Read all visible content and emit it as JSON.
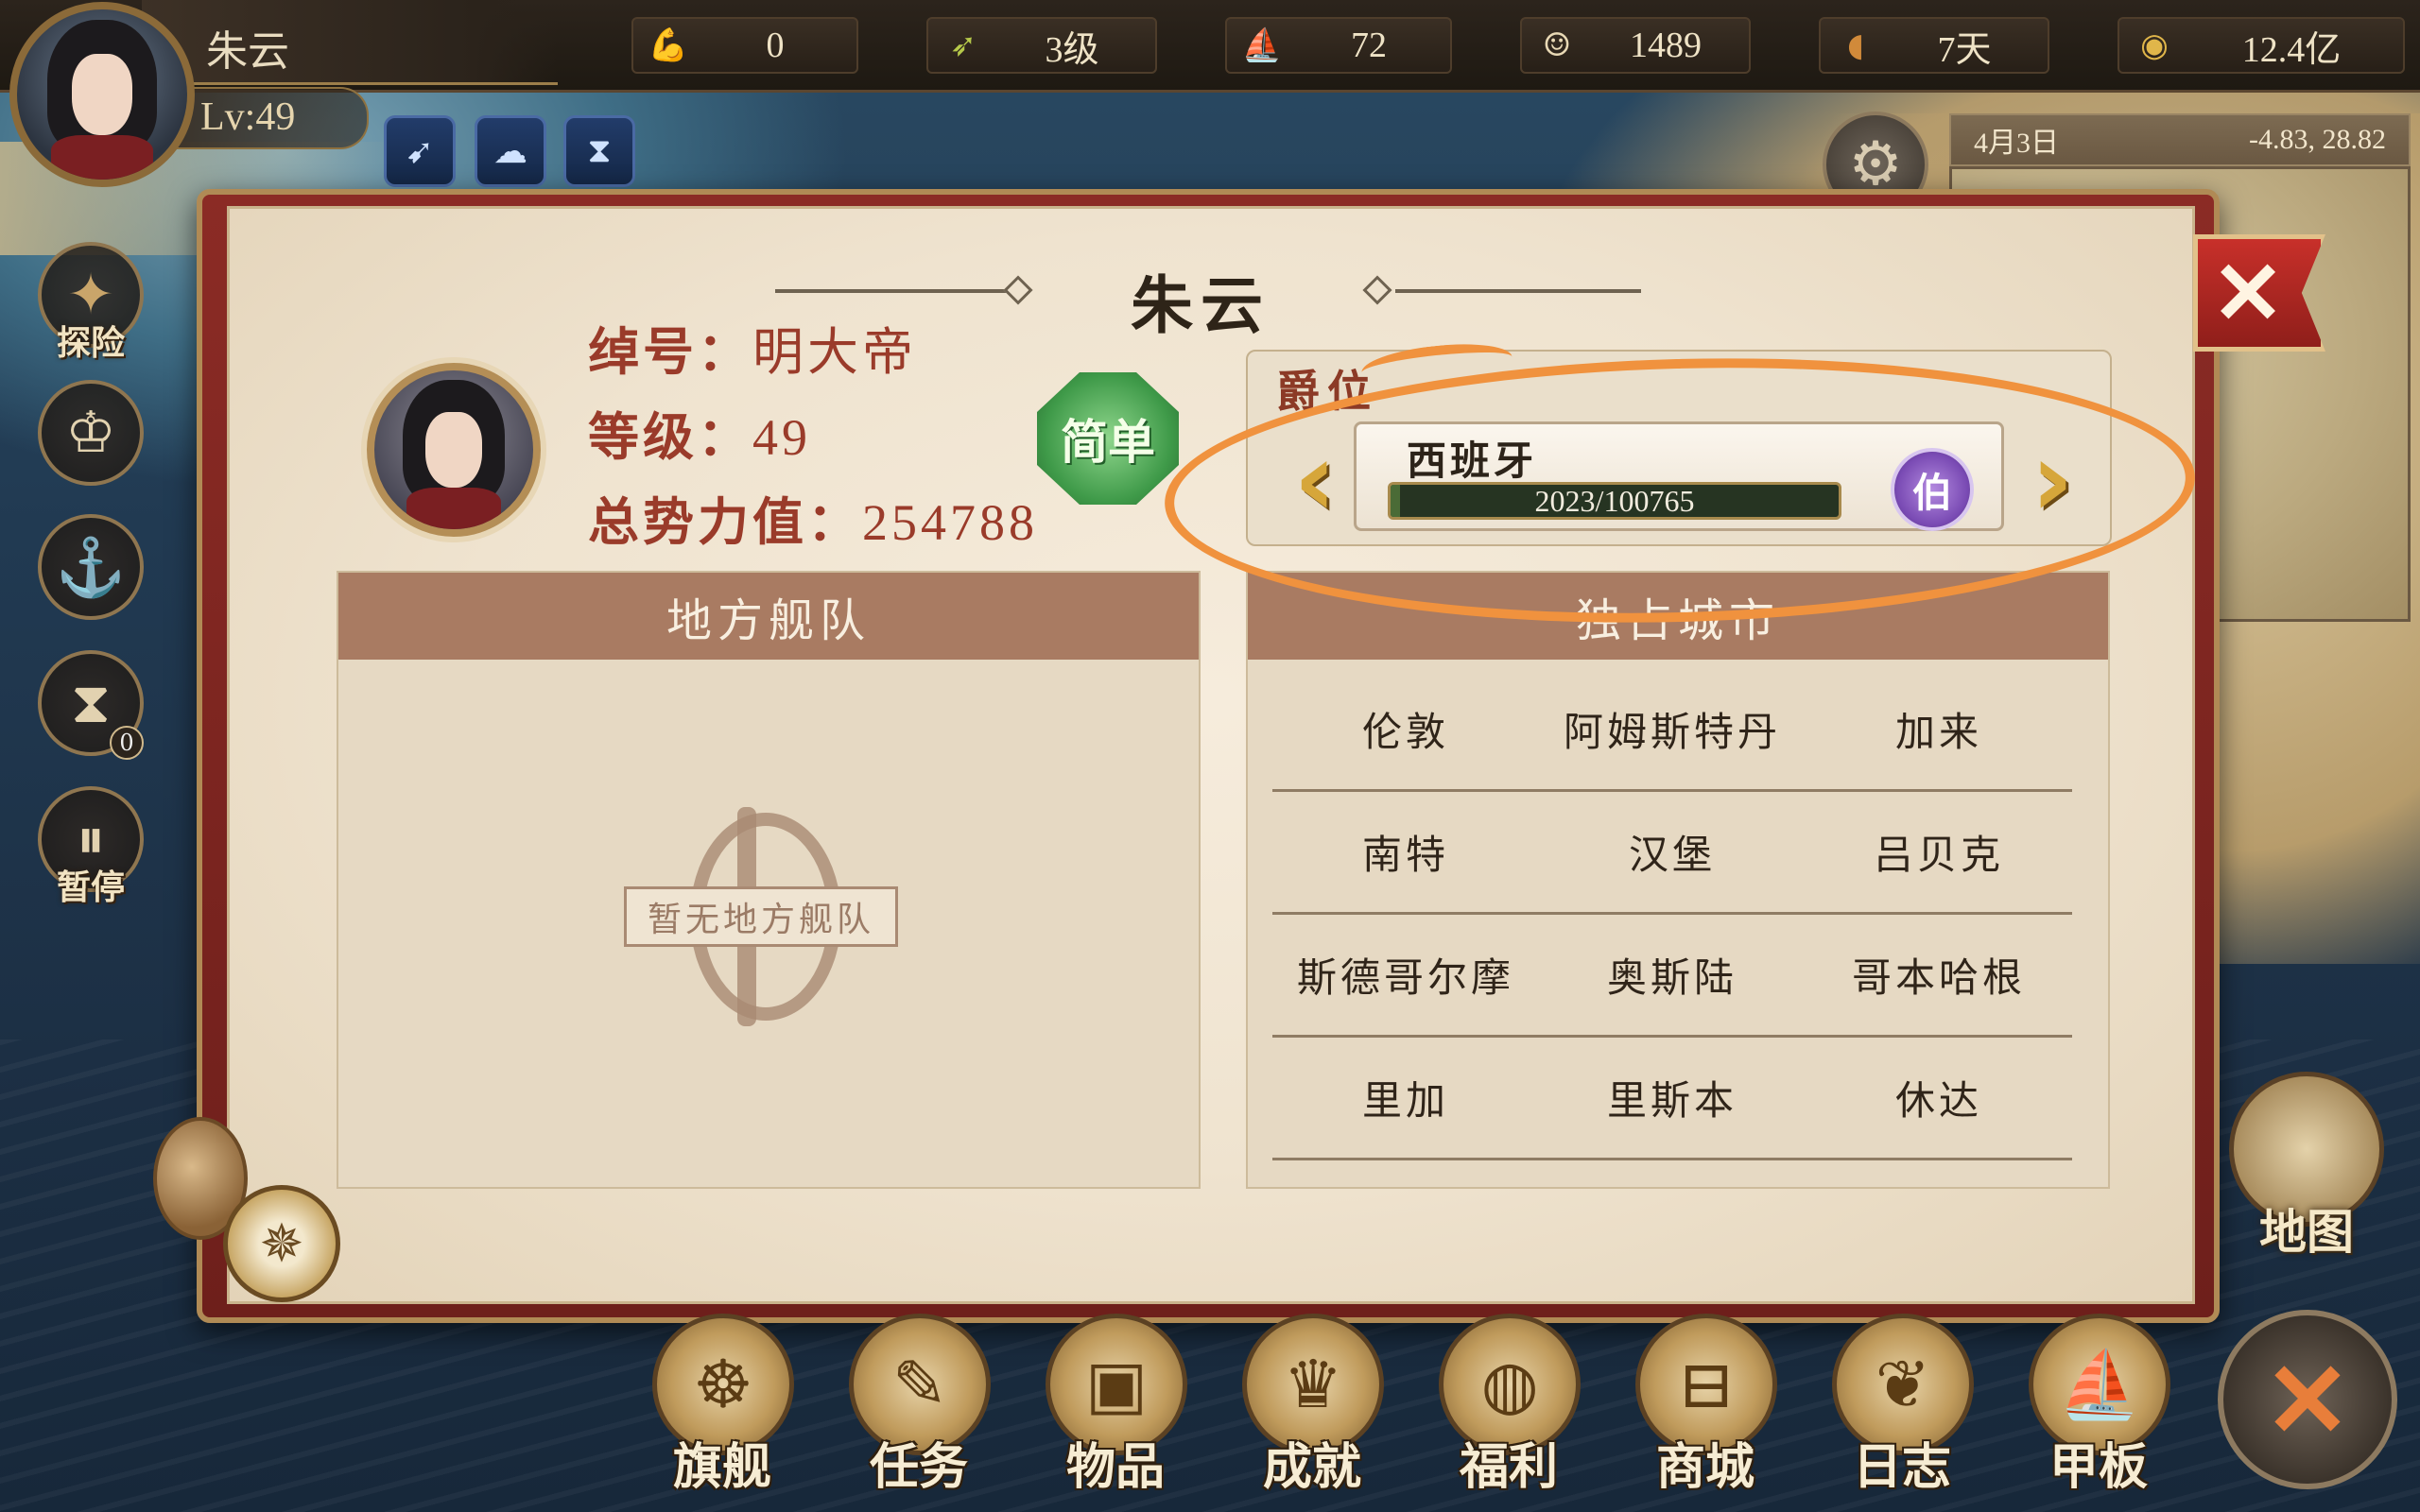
{
  "player": {
    "name": "朱云",
    "level_text": "Lv:49"
  },
  "resources": [
    {
      "icon": "strength-arm-icon",
      "value": "0"
    },
    {
      "icon": "arrow-icon",
      "value": "3级"
    },
    {
      "icon": "ship-icon",
      "value": "72"
    },
    {
      "icon": "sailor-icon",
      "value": "1489"
    },
    {
      "icon": "bread-icon",
      "value": "7天"
    },
    {
      "icon": "gold-coin-icon",
      "value": "12.4亿"
    }
  ],
  "buffs": [
    "feather-buff-icon",
    "brain-buff-icon",
    "hourglass-buff-icon"
  ],
  "date_box": {
    "date": "4月3日",
    "coords": "-4.83, 28.82"
  },
  "side_menu": {
    "explore_label": "探险",
    "pause_label": "暂停",
    "hourglass_badge": "0"
  },
  "map_button": {
    "label": "地图"
  },
  "bottom_menu": [
    {
      "label": "旗舰",
      "icon": "helm-wheel-icon"
    },
    {
      "label": "任务",
      "icon": "scroll-quill-icon"
    },
    {
      "label": "物品",
      "icon": "satchel-icon"
    },
    {
      "label": "成就",
      "icon": "trophy-icon"
    },
    {
      "label": "福利",
      "icon": "money-bag-icon"
    },
    {
      "label": "商城",
      "icon": "treasure-chest-icon"
    },
    {
      "label": "日志",
      "icon": "journal-icon"
    },
    {
      "label": "甲板",
      "icon": "sailing-ship-icon"
    }
  ],
  "dialog": {
    "title": "朱云",
    "close_symbol": "✕",
    "profile": {
      "title_label": "绰号：",
      "title_value": "明大帝",
      "level_label": "等级：",
      "level_value": "49",
      "power_label": "总势力值：",
      "power_value": "254788"
    },
    "difficulty": "简单",
    "nobility": {
      "section_title": "爵位",
      "nation": "西班牙",
      "progress_text": "2023/100765",
      "progress_current": 2023,
      "progress_max": 100765,
      "rank": "伯",
      "prev_symbol": "‹",
      "next_symbol": "›"
    },
    "local_fleet": {
      "header": "地方舰队",
      "empty_text": "暂无地方舰队"
    },
    "monopoly_cities": {
      "header": "独占城市",
      "rows": [
        [
          "伦敦",
          "阿姆斯特丹",
          "加来"
        ],
        [
          "南特",
          "汉堡",
          "吕贝克"
        ],
        [
          "斯德哥尔摩",
          "奥斯陆",
          "哥本哈根"
        ],
        [
          "里加",
          "里斯本",
          "休达"
        ]
      ]
    }
  },
  "colors": {
    "highlight": "#f0923e",
    "dialog_frame": "#8b2b25",
    "accent_text": "#9a3b2a",
    "panel_header": "#a97b62"
  }
}
